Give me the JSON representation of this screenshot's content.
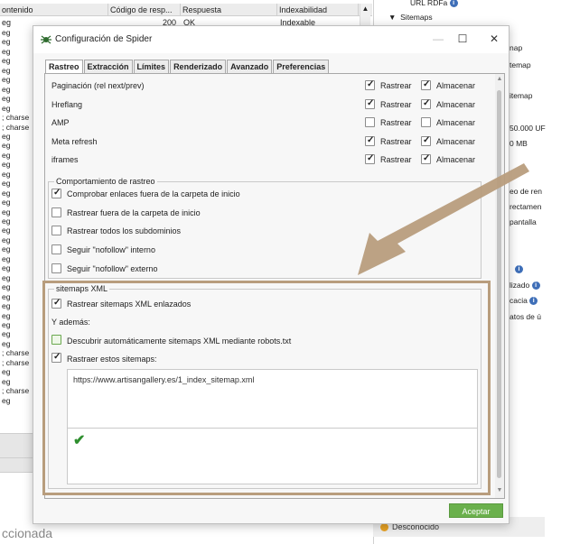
{
  "background": {
    "table_headers": [
      "ontenido",
      "Código de resp...",
      "Respuesta",
      "Indexabilidad",
      "+"
    ],
    "first_row": {
      "code": "200",
      "response": "OK",
      "indexability": "Indexable"
    },
    "row_labels": [
      "eg",
      "eg",
      "eg",
      "eg",
      "eg",
      "eg",
      "eg",
      "eg",
      "eg",
      "eg",
      "; charse",
      "; charse",
      "eg",
      "eg",
      "eg",
      "eg",
      "eg",
      "eg",
      "eg",
      "eg",
      "eg",
      "eg",
      "eg",
      "eg",
      "eg",
      "eg",
      "eg",
      "eg",
      "eg",
      "eg",
      "eg",
      "eg",
      "eg",
      "eg",
      "eg",
      "; charse",
      "; charse",
      "eg",
      "eg",
      "; charse",
      "eg"
    ],
    "footer": "ccionada",
    "right_panel": {
      "top_item": "URL RDFa",
      "sitemaps": "Sitemaps",
      "items": [
        "nap",
        "temap",
        "itemap",
        "50.000 UF",
        "0 MB",
        "eo de ren",
        "rectamen",
        "pantalla",
        "lizado",
        "cacia",
        "atos de ú"
      ],
      "description": "Desconocido"
    }
  },
  "dialog": {
    "title": "Configuración de Spider",
    "window_buttons": {
      "minimize": "—",
      "maximize": "☐",
      "close": "✕"
    },
    "tabs": [
      "Rastreo",
      "Extracción",
      "Límites",
      "Renderizado",
      "Avanzado",
      "Preferencias"
    ],
    "active_tab": "Rastreo",
    "crawl_rows": [
      {
        "label": "Paginación (rel next/prev)",
        "rastrear": true,
        "almacenar": true
      },
      {
        "label": "Hreflang",
        "rastrear": true,
        "almacenar": true
      },
      {
        "label": "AMP",
        "rastrear": false,
        "almacenar": false
      },
      {
        "label": "Meta refresh",
        "rastrear": true,
        "almacenar": true
      },
      {
        "label": "iframes",
        "rastrear": true,
        "almacenar": true
      }
    ],
    "col_rastrear": "Rastrear",
    "col_almacenar": "Almacenar",
    "behavior": {
      "title": "Comportamiento de rastreo",
      "options": [
        {
          "label": "Comprobar enlaces fuera de la carpeta de inicio",
          "checked": true
        },
        {
          "label": "Rastrear fuera de la carpeta de inicio",
          "checked": false
        },
        {
          "label": "Rastrear todos los subdominios",
          "checked": false
        },
        {
          "label": "Seguir \"nofollow\" interno",
          "checked": false
        },
        {
          "label": "Seguir \"nofollow\" externo",
          "checked": false
        }
      ]
    },
    "sitemaps": {
      "title": "sitemaps XML",
      "crawl_linked": {
        "label": "Rastrear sitemaps XML enlazados",
        "checked": true
      },
      "also": "Y además:",
      "auto_discover": {
        "label": "Descubrir automáticamente sitemaps XML mediante robots.txt",
        "checked": false
      },
      "crawl_these": {
        "label": "Rastraer estos sitemaps:",
        "checked": true
      },
      "url": "https://www.artisangallery.es/1_index_sitemap.xml",
      "valid_icon": "✔"
    },
    "accept_label": "Aceptar"
  },
  "colors": {
    "highlight": "#b89d7d",
    "accept": "#6ab04c",
    "arrow": "#b89d7d",
    "valid": "#2f8f2f"
  }
}
